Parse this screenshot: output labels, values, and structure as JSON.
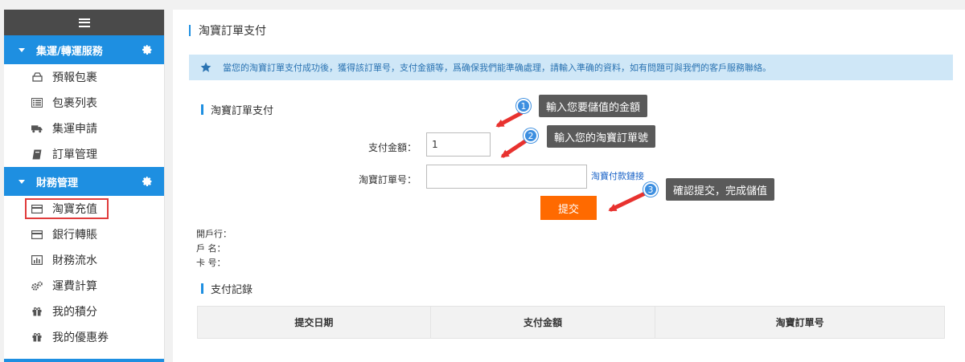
{
  "sidebar": {
    "sections": [
      {
        "title": "集運/轉運服務",
        "items": [
          {
            "label": "預報包裹",
            "icon": "package-icon"
          },
          {
            "label": "包裹列表",
            "icon": "list-icon"
          },
          {
            "label": "集運申請",
            "icon": "truck-icon"
          },
          {
            "label": "訂單管理",
            "icon": "book-icon"
          }
        ]
      },
      {
        "title": "財務管理",
        "items": [
          {
            "label": "淘寶充值",
            "icon": "card-icon",
            "active": true
          },
          {
            "label": "銀行轉賬",
            "icon": "card-icon"
          },
          {
            "label": "財務流水",
            "icon": "bar-chart-icon"
          },
          {
            "label": "運費計算",
            "icon": "cogs-icon"
          },
          {
            "label": "我的積分",
            "icon": "gift-icon"
          },
          {
            "label": "我的優惠券",
            "icon": "gift-icon"
          }
        ]
      }
    ]
  },
  "main": {
    "page_title": "淘寶訂單支付",
    "notice": "當您的淘寶訂單支付成功後，獲得該訂單号，支付金額等，爲确保我們能準确處理，請輸入準确的資料，如有問題可與我們的客戶服務聯絡。",
    "form_title": "淘寶訂單支付",
    "amount_label": "支付金額：",
    "amount_value": "1",
    "order_label": "淘寶訂單号：",
    "order_value": "",
    "payment_link": "淘寶付款鏈接",
    "submit_label": "提交",
    "account": {
      "bank_label": "開戶行：",
      "name_label": "戶 名：",
      "card_label": "卡 号："
    },
    "records_title": "支付記錄",
    "records_headers": [
      "提交日期",
      "支付金額",
      "淘寶訂單号"
    ]
  },
  "callouts": [
    {
      "num": "1",
      "text": "輸入您要儲值的金額"
    },
    {
      "num": "2",
      "text": "輸入您的淘寶訂單號"
    },
    {
      "num": "3",
      "text": "確認提交，完成儲值"
    }
  ],
  "colors": {
    "accent": "#1e8fe1",
    "submit": "#ff6a00",
    "highlight": "#e03c3c",
    "arrow": "#e8322f",
    "callout_bg": "#5a5a5a",
    "notice_bg": "#cfe7f7"
  }
}
